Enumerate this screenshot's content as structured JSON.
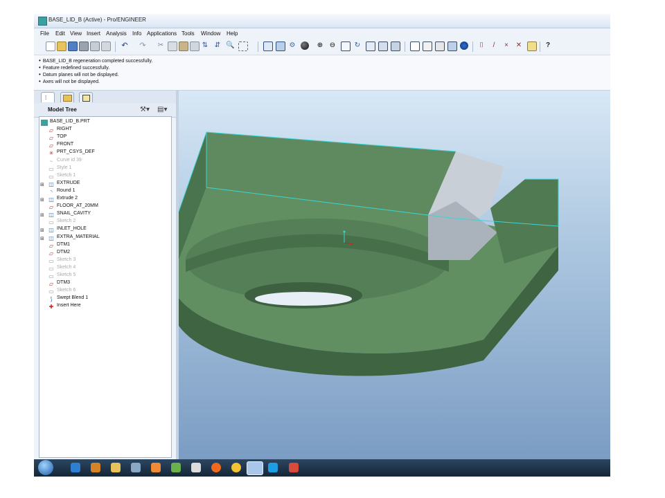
{
  "window": {
    "title": "BASE_LID_B (Active) - Pro/ENGINEER"
  },
  "menu": [
    "File",
    "Edit",
    "View",
    "Insert",
    "Analysis",
    "Info",
    "Applications",
    "Tools",
    "Window",
    "Help"
  ],
  "messages": [
    "BASE_LID_B regeneration completed successfully.",
    "Feature redefined successfully.",
    "Datum planes will not be displayed.",
    "Axes will not be displayed."
  ],
  "model_tree": {
    "header": "Model Tree",
    "items": [
      {
        "label": "BASE_LID_B.PRT",
        "icon": "part-icon",
        "dim": false,
        "exp": false,
        "indent": 0
      },
      {
        "label": "RIGHT",
        "icon": "datum-plane-icon",
        "dim": false,
        "exp": false,
        "indent": 1
      },
      {
        "label": "TOP",
        "icon": "datum-plane-icon",
        "dim": false,
        "exp": false,
        "indent": 1
      },
      {
        "label": "FRONT",
        "icon": "datum-plane-icon",
        "dim": false,
        "exp": false,
        "indent": 1
      },
      {
        "label": "PRT_CSYS_DEF",
        "icon": "csys-icon",
        "dim": false,
        "exp": false,
        "indent": 1
      },
      {
        "label": "Curve id 39",
        "icon": "curve-icon",
        "dim": true,
        "exp": false,
        "indent": 1
      },
      {
        "label": "Style 1",
        "icon": "style-icon",
        "dim": true,
        "exp": false,
        "indent": 1
      },
      {
        "label": "Sketch 1",
        "icon": "sketch-icon",
        "dim": true,
        "exp": false,
        "indent": 1
      },
      {
        "label": "EXTRUDE",
        "icon": "extrude-icon",
        "dim": false,
        "exp": true,
        "indent": 1
      },
      {
        "label": "Round 1",
        "icon": "round-icon",
        "dim": false,
        "exp": false,
        "indent": 1
      },
      {
        "label": "Extrude 2",
        "icon": "extrude-icon",
        "dim": false,
        "exp": true,
        "indent": 1
      },
      {
        "label": "FLOOR_AT_20MM",
        "icon": "datum-plane-icon",
        "dim": false,
        "exp": false,
        "indent": 1
      },
      {
        "label": "SNAIL_CAVITY",
        "icon": "extrude-icon",
        "dim": false,
        "exp": true,
        "indent": 1
      },
      {
        "label": "Sketch 2",
        "icon": "sketch-icon",
        "dim": true,
        "exp": false,
        "indent": 1
      },
      {
        "label": "INLET_HOLE",
        "icon": "extrude-icon",
        "dim": false,
        "exp": true,
        "indent": 1
      },
      {
        "label": "EXTRA_MATERIAL",
        "icon": "extrude-icon",
        "dim": false,
        "exp": true,
        "indent": 1
      },
      {
        "label": "DTM1",
        "icon": "datum-plane-icon",
        "dim": false,
        "exp": false,
        "indent": 1
      },
      {
        "label": "DTM2",
        "icon": "datum-plane-icon",
        "dim": false,
        "exp": false,
        "indent": 1
      },
      {
        "label": "Sketch 3",
        "icon": "sketch-icon",
        "dim": true,
        "exp": false,
        "indent": 1
      },
      {
        "label": "Sketch 4",
        "icon": "sketch-icon",
        "dim": true,
        "exp": false,
        "indent": 1
      },
      {
        "label": "Sketch 5",
        "icon": "sketch-icon",
        "dim": true,
        "exp": false,
        "indent": 1
      },
      {
        "label": "DTM3",
        "icon": "datum-plane-icon",
        "dim": false,
        "exp": false,
        "indent": 1
      },
      {
        "label": "Sketch 6",
        "icon": "sketch-icon",
        "dim": true,
        "exp": false,
        "indent": 1
      },
      {
        "label": "Swept Blend 1",
        "icon": "swept-blend-icon",
        "dim": false,
        "exp": false,
        "indent": 1
      },
      {
        "label": "Insert Here",
        "icon": "insert-here-icon",
        "dim": false,
        "exp": false,
        "indent": 1
      }
    ]
  },
  "colors": {
    "model_green": "#5f8a5f",
    "model_dark_green": "#3f6442",
    "edge_cyan": "#39d6d6",
    "cavity_grey": "#c9cfd6",
    "insert_red": "#d21e1e"
  }
}
